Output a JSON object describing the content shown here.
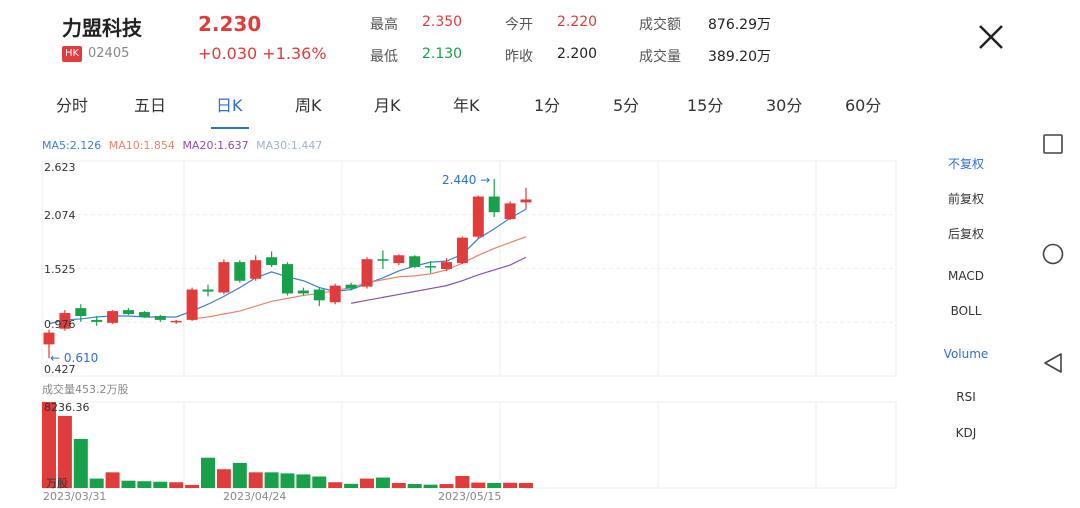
{
  "header": {
    "name": "力盟科技",
    "price": "2.230",
    "exchange_badge": "HK",
    "code": "02405",
    "change": "+0.030 +1.36%",
    "stats": [
      {
        "label": "最高",
        "value": "2.350",
        "color": "red"
      },
      {
        "label": "今开",
        "value": "2.220",
        "color": "red"
      },
      {
        "label": "成交额",
        "value": "876.29万",
        "color": "dark"
      },
      {
        "label": "最低",
        "value": "2.130",
        "color": "green"
      },
      {
        "label": "昨收",
        "value": "2.200",
        "color": "dark"
      },
      {
        "label": "成交量",
        "value": "389.20万",
        "color": "dark"
      }
    ]
  },
  "tabs": [
    "分时",
    "五日",
    "日K",
    "周K",
    "月K",
    "年K",
    "1分",
    "5分",
    "15分",
    "30分",
    "60分"
  ],
  "active_tab": "日K",
  "ma": {
    "ma5": "MA5:2.126",
    "ma10": "MA10:1.854",
    "ma20": "MA20:1.637",
    "ma30": "MA30:1.447"
  },
  "side_menu": [
    "不复权",
    "前复权",
    "后复权",
    "MACD",
    "BOLL",
    "Volume",
    "RSI",
    "KDJ"
  ],
  "side_active": [
    "不复权",
    "Volume"
  ],
  "volume": {
    "title": "成交量453.2万股",
    "max_label": "8236.36",
    "unit_label": "万股"
  },
  "colors": {
    "up": "#e03c3c",
    "down": "#19a04a",
    "accent": "#2f6fd0",
    "ma5": "#3d7fd6",
    "ma10": "#e8836b",
    "ma20": "#8a4fb3",
    "ma30": "#9fb3c8"
  },
  "chart_data": {
    "type": "candlestick",
    "y_ticks": [
      "2.623",
      "2.074",
      "1.525",
      "0.976",
      "0.427"
    ],
    "ylim": [
      0.427,
      2.623
    ],
    "x_labels": [
      "2023/03/31",
      "2023/04/24",
      "2023/05/15"
    ],
    "annotations": {
      "high": {
        "text": "2.440 →",
        "value": 2.44
      },
      "low": {
        "text": "← 0.610",
        "value": 0.61
      }
    },
    "candles": [
      {
        "o": 0.75,
        "c": 0.87,
        "h": 0.9,
        "l": 0.61
      },
      {
        "o": 0.91,
        "c": 1.07,
        "h": 1.1,
        "l": 0.89
      },
      {
        "o": 1.12,
        "c": 1.04,
        "h": 1.16,
        "l": 0.98
      },
      {
        "o": 1.0,
        "c": 0.98,
        "h": 1.04,
        "l": 0.94
      },
      {
        "o": 0.97,
        "c": 1.09,
        "h": 1.1,
        "l": 0.96
      },
      {
        "o": 1.1,
        "c": 1.06,
        "h": 1.12,
        "l": 1.05
      },
      {
        "o": 1.08,
        "c": 1.03,
        "h": 1.09,
        "l": 1.02
      },
      {
        "o": 1.04,
        "c": 1.0,
        "h": 1.05,
        "l": 0.98
      },
      {
        "o": 0.98,
        "c": 0.99,
        "h": 1.0,
        "l": 0.96
      },
      {
        "o": 1.0,
        "c": 1.31,
        "h": 1.33,
        "l": 0.99
      },
      {
        "o": 1.31,
        "c": 1.29,
        "h": 1.36,
        "l": 1.24
      },
      {
        "o": 1.28,
        "c": 1.59,
        "h": 1.62,
        "l": 1.26
      },
      {
        "o": 1.59,
        "c": 1.4,
        "h": 1.61,
        "l": 1.38
      },
      {
        "o": 1.42,
        "c": 1.61,
        "h": 1.66,
        "l": 1.4
      },
      {
        "o": 1.64,
        "c": 1.56,
        "h": 1.7,
        "l": 1.54
      },
      {
        "o": 1.57,
        "c": 1.27,
        "h": 1.59,
        "l": 1.25
      },
      {
        "o": 1.3,
        "c": 1.27,
        "h": 1.33,
        "l": 1.25
      },
      {
        "o": 1.31,
        "c": 1.2,
        "h": 1.33,
        "l": 1.14
      },
      {
        "o": 1.18,
        "c": 1.35,
        "h": 1.37,
        "l": 1.16
      },
      {
        "o": 1.36,
        "c": 1.32,
        "h": 1.38,
        "l": 1.3
      },
      {
        "o": 1.34,
        "c": 1.62,
        "h": 1.64,
        "l": 1.32
      },
      {
        "o": 1.62,
        "c": 1.61,
        "h": 1.71,
        "l": 1.52
      },
      {
        "o": 1.58,
        "c": 1.66,
        "h": 1.67,
        "l": 1.56
      },
      {
        "o": 1.65,
        "c": 1.54,
        "h": 1.66,
        "l": 1.53
      },
      {
        "o": 1.55,
        "c": 1.54,
        "h": 1.6,
        "l": 1.48
      },
      {
        "o": 1.52,
        "c": 1.59,
        "h": 1.63,
        "l": 1.5
      },
      {
        "o": 1.58,
        "c": 1.84,
        "h": 1.85,
        "l": 1.57
      },
      {
        "o": 1.85,
        "c": 2.26,
        "h": 2.27,
        "l": 1.83
      },
      {
        "o": 2.26,
        "c": 2.1,
        "h": 2.44,
        "l": 2.05
      },
      {
        "o": 2.03,
        "c": 2.19,
        "h": 2.21,
        "l": 2.02
      },
      {
        "o": 2.2,
        "c": 2.23,
        "h": 2.35,
        "l": 2.13
      }
    ],
    "ma_lines": {
      "ma5": [
        0.96,
        1.0,
        1.01,
        1.03,
        1.04,
        1.04,
        1.03,
        1.03,
        1.03,
        1.09,
        1.16,
        1.24,
        1.33,
        1.43,
        1.49,
        1.44,
        1.4,
        1.33,
        1.29,
        1.31,
        1.37,
        1.43,
        1.5,
        1.55,
        1.59,
        1.6,
        1.67,
        1.83,
        1.93,
        2.04,
        2.13
      ],
      "ma10": [
        null,
        null,
        null,
        null,
        null,
        null,
        null,
        null,
        null,
        1.01,
        1.03,
        1.06,
        1.09,
        1.14,
        1.19,
        1.22,
        1.25,
        1.27,
        1.3,
        1.33,
        1.38,
        1.41,
        1.44,
        1.45,
        1.47,
        1.51,
        1.58,
        1.66,
        1.73,
        1.79,
        1.85
      ],
      "ma20": [
        null,
        null,
        null,
        null,
        null,
        null,
        null,
        null,
        null,
        null,
        null,
        null,
        null,
        null,
        null,
        null,
        null,
        null,
        null,
        1.17,
        1.2,
        1.23,
        1.26,
        1.29,
        1.32,
        1.35,
        1.4,
        1.46,
        1.51,
        1.56,
        1.64
      ]
    },
    "volume_max": 8236.36,
    "volume_values": [
      8236,
      6900,
      4700,
      900,
      1500,
      700,
      650,
      600,
      550,
      300,
      2900,
      1800,
      2400,
      1500,
      1500,
      1400,
      1300,
      1100,
      550,
      400,
      900,
      1000,
      480,
      380,
      320,
      380,
      1150,
      520,
      480,
      500,
      480
    ]
  }
}
